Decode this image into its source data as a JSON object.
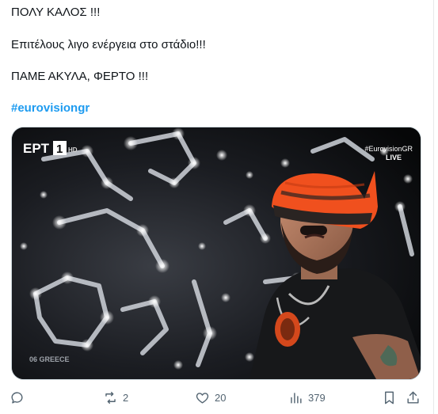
{
  "tweet": {
    "lines": [
      "ΠΟΛΥ ΚΑΛΟΣ !!!",
      "Επιτέλους λιγο ενέργεια στο στάδιο!!!",
      "ΠΑΜΕ ΑΚΥΛΑ, ΦΕΡΤΟ !!!"
    ],
    "hashtag": "#eurovisiongr"
  },
  "video": {
    "channel_logo": "ΕΡΤ",
    "channel_number": "1",
    "hd_label": "HD",
    "tag": "#EurovisionGR",
    "live_label": "LIVE",
    "caption": "06 GREECE"
  },
  "actions": {
    "reply_count": "",
    "retweet_count": "2",
    "like_count": "20",
    "views_count": "379"
  },
  "colors": {
    "hashtag": "#1d9bf0",
    "icon": "#536471",
    "hat_orange": "#f0501e"
  }
}
